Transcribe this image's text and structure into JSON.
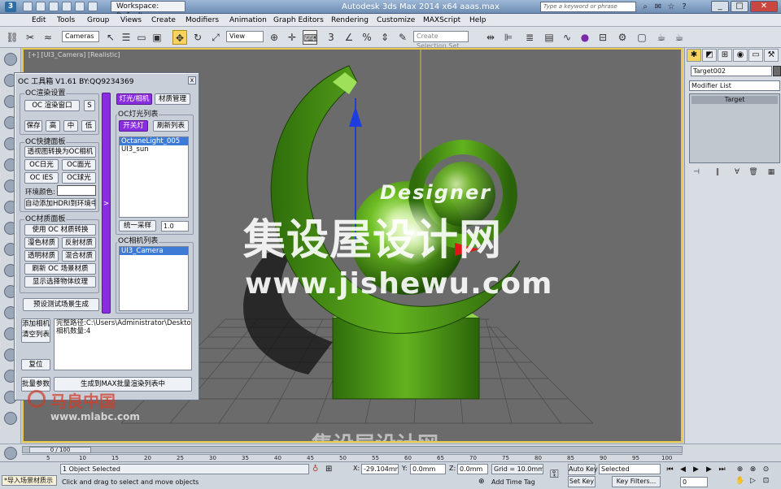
{
  "titlebar": {
    "workspace": "Workspace: Default",
    "app_title": "Autodesk 3ds Max  2014 x64       aaas.max",
    "search_placeholder": "Type a keyword or phrase"
  },
  "menu": [
    "Edit",
    "Tools",
    "Group",
    "Views",
    "Create",
    "Modifiers",
    "Animation",
    "Graph Editors",
    "Rendering",
    "Customize",
    "MAXScript",
    "Help"
  ],
  "toolbar": {
    "ref_coord": "Cameras",
    "view": "View",
    "selection_set_placeholder": "Create Selection Set"
  },
  "viewport": {
    "label": "[+] [UI3_Camera] [Realistic]",
    "watermarks": {
      "designer": "Designer",
      "site_cn": "集设屋设计网",
      "site_url": "www.jishewu.com",
      "bottom_cn": "集设屋设计网",
      "logo_cn": "马良中国",
      "logo_url": "www.mlabc.com"
    },
    "colors": {
      "object": "#4a9e12",
      "bg": "#6b6b6b",
      "frame": "#e8c94a"
    }
  },
  "oc_panel": {
    "title": "OC 工具箱 V1.61  BY:QQ9234369",
    "render_group": "OC渲染设置",
    "render_window": "OC 渲染窗口",
    "s_btn": "S",
    "save": "保存",
    "high": "高",
    "mid": "中",
    "low": "低",
    "quick_group": "OC快捷面板",
    "persp_to_camera": "透视图转换为OC相机",
    "oc_sun": "OC日光",
    "oc_area": "OC面光",
    "oc_ies": "OC IES",
    "oc_sphere": "OC球光",
    "env_color": "环境颜色:",
    "add_hdri": "自动添加HDRI到环境中",
    "material_group": "OC材质面板",
    "use_oc_mat": "使用 OC 材质转换",
    "diffuse": "漫色材质",
    "reflect": "反射材质",
    "transparent": "透明材质",
    "mix": "混合材质",
    "refresh_scene": "刷新 OC 场景材质",
    "show_texture": "显示选择物体纹理",
    "preset_test": "预设测试场景生成",
    "add_camera": "添加相机",
    "clear_list": "清空列表",
    "reset": "复位",
    "batch_params": "批量参数",
    "generate_batch": "生成到MAX批量渲染列表中",
    "side_arrow": ">",
    "tabs": {
      "lights_cameras": "灯光/相机",
      "material_manage": "材质管理"
    },
    "light_list_group": "OC灯光列表",
    "switch_light": "开关灯",
    "refresh_list": "刷新列表",
    "lights": [
      "OctaneLight_005",
      "UI3_sun"
    ],
    "uniform_sample": "统一采样",
    "sample_value": "1.0",
    "camera_list_group": "OC相机列表",
    "cameras": [
      "UI3_Camera"
    ],
    "path_text": "完整路径:C:\\Users\\Administrator\\Desktop\\aaa\\CT",
    "camera_count": "相机数量:4"
  },
  "right_panel": {
    "object_name": "Target002",
    "modifier_list": "Modifier List",
    "stack_item": "Target"
  },
  "timeline": {
    "thumb": "0 / 100",
    "ticks": [
      "5",
      "10",
      "15",
      "20",
      "25",
      "30",
      "35",
      "40",
      "45",
      "50",
      "55",
      "60",
      "65",
      "70",
      "75",
      "80",
      "85",
      "90",
      "95",
      "100"
    ]
  },
  "status": {
    "script_label": "*导入场景材质示",
    "objects_selected": "1 Object Selected",
    "prompt": "Click and drag to select and move objects",
    "x_label": "X:",
    "x_value": "-29.104mm",
    "y_label": "Y:",
    "y_value": "0.0mm",
    "z_label": "Z:",
    "z_value": "0.0mm",
    "grid": "Grid = 10.0mm",
    "add_time_tag": "Add Time Tag",
    "auto_key": "Auto Key",
    "set_key": "Set Key",
    "selected": "Selected",
    "key_filters": "Key Filters...",
    "frame": "0"
  }
}
